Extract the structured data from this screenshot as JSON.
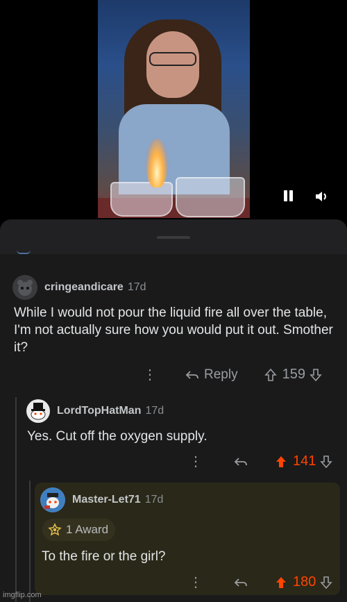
{
  "video": {
    "controls": {
      "pause_icon": "pause-icon",
      "sound_icon": "sound-icon"
    }
  },
  "comments": [
    {
      "username": "cringeandicare",
      "age": "17d",
      "text": "While I would not pour the liquid fire all over the table, I'm not actually sure how you would put it out. Smother it?",
      "reply_label": "Reply",
      "votes": "159",
      "upvoted": false
    },
    {
      "username": "LordTopHatMan",
      "age": "17d",
      "text": "Yes. Cut off the oxygen supply.",
      "votes": "141",
      "upvoted": true
    },
    {
      "username": "Master-Let71",
      "age": "17d",
      "award": "1 Award",
      "text": "To the fire or the girl?",
      "votes": "180",
      "upvoted": true
    }
  ],
  "watermark": "imgflip.com",
  "colors": {
    "upvote": "#ff4500",
    "background": "#1a1a1b",
    "highlight": "#2a2818"
  }
}
